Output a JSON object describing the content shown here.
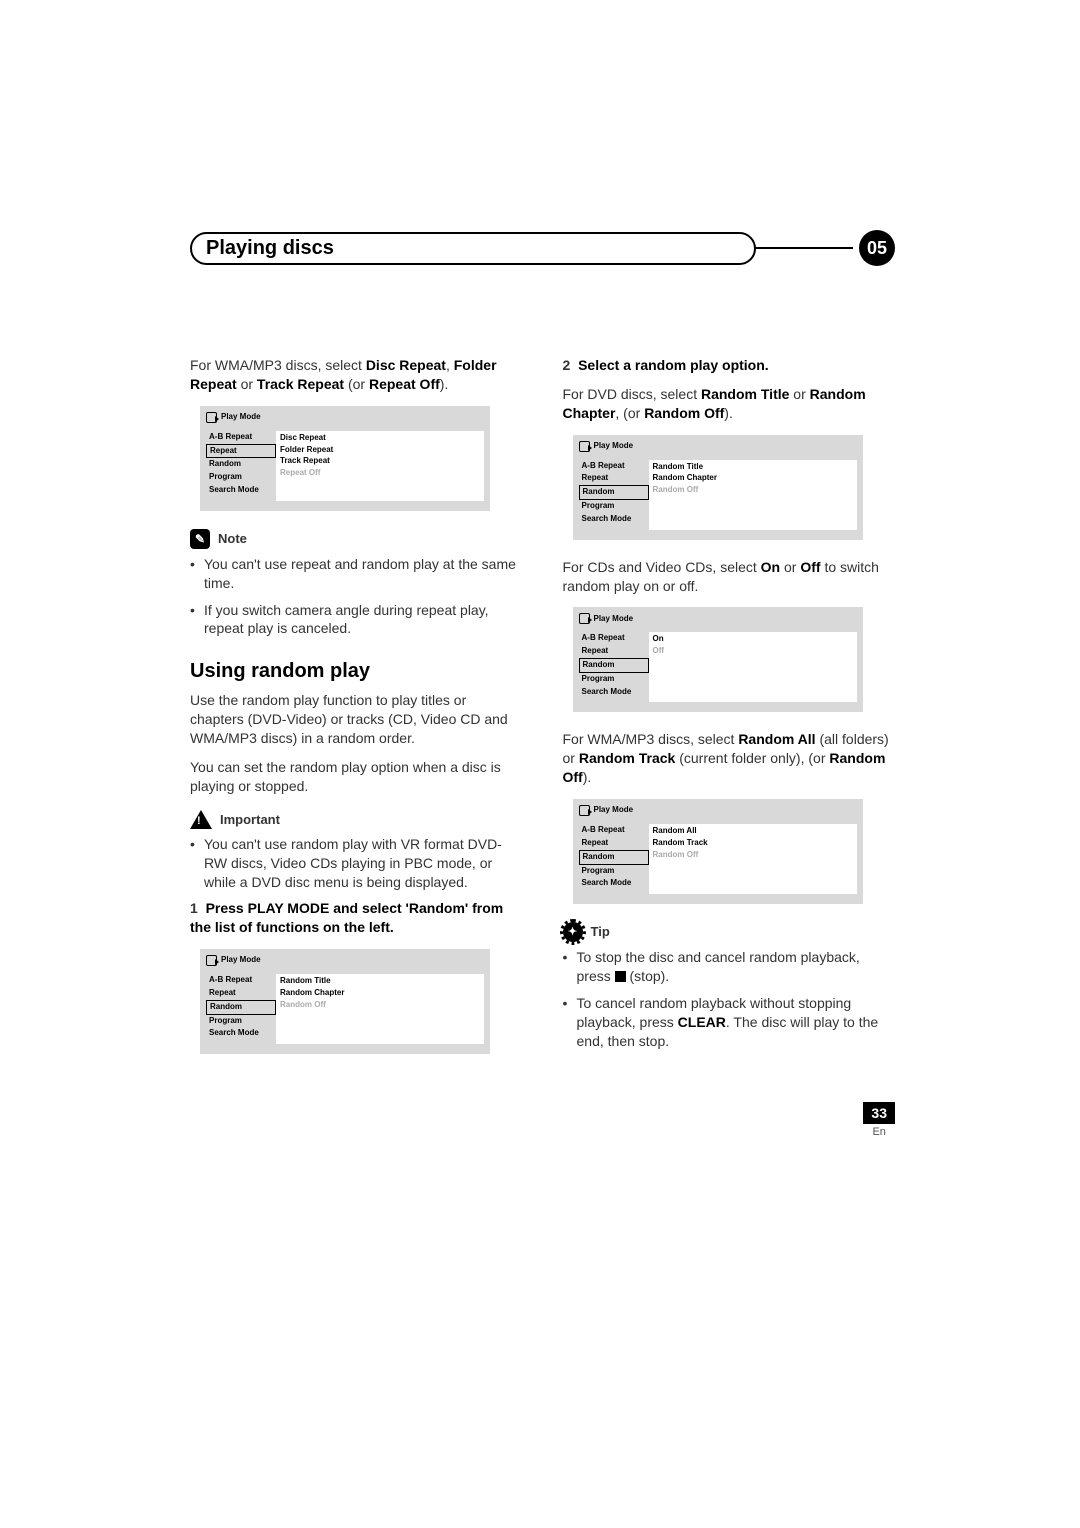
{
  "header": {
    "chapter_title": "Playing discs",
    "chapter_number": "05"
  },
  "left": {
    "intro_prefix": "For WMA/MP3 discs, select ",
    "intro_b1": "Disc Repeat",
    "intro_mid1": ", ",
    "intro_b2": "Folder Repeat",
    "intro_mid2": " or ",
    "intro_b3": "Track Repeat",
    "intro_mid3": " (or ",
    "intro_b4": "Repeat Off",
    "intro_suffix": ").",
    "menu1": {
      "title": "Play Mode",
      "left": [
        "A-B Repeat",
        "Repeat",
        "Random",
        "Program",
        "Search Mode"
      ],
      "selected": "Repeat",
      "right": [
        "Disc Repeat",
        "Folder Repeat",
        "Track Repeat"
      ],
      "right_dim": "Repeat Off"
    },
    "note_label": "Note",
    "note_items": [
      "You can't use repeat and random play at the same time.",
      "If you switch camera angle during repeat play, repeat play is canceled."
    ],
    "h2": "Using random play",
    "p1": "Use the random play function to play titles or chapters (DVD-Video) or tracks (CD, Video CD and WMA/MP3 discs) in a random order.",
    "p2": "You can set the random play option when a disc is playing or stopped.",
    "important_label": "Important",
    "important_items": [
      "You can't use random play with VR format DVD-RW discs, Video CDs playing in PBC mode, or while a DVD disc menu is being displayed."
    ],
    "step1_num": "1",
    "step1_text": "Press PLAY MODE and select 'Random' from the list of functions on the left.",
    "menu2": {
      "title": "Play Mode",
      "left": [
        "A-B Repeat",
        "Repeat",
        "Random",
        "Program",
        "Search Mode"
      ],
      "selected": "Random",
      "right": [
        "Random Title",
        "Random Chapter"
      ],
      "right_dim": "Random Off"
    }
  },
  "right": {
    "step2_num": "2",
    "step2_text": "Select a random play option.",
    "dvd_prefix": "For DVD discs, select ",
    "dvd_b1": "Random Title",
    "dvd_mid1": " or ",
    "dvd_b2": "Random Chapter",
    "dvd_mid2": ", (or ",
    "dvd_b3": "Random Off",
    "dvd_suffix": ").",
    "menu3": {
      "title": "Play Mode",
      "left": [
        "A-B Repeat",
        "Repeat",
        "Random",
        "Program",
        "Search Mode"
      ],
      "selected": "Random",
      "right": [
        "Random Title",
        "Random Chapter"
      ],
      "right_dim": "Random Off"
    },
    "cd_prefix": "For CDs and Video CDs, select ",
    "cd_b1": "On",
    "cd_mid": " or ",
    "cd_b2": "Off",
    "cd_suffix": " to switch random play on or off.",
    "menu4": {
      "title": "Play Mode",
      "left": [
        "A-B Repeat",
        "Repeat",
        "Random",
        "Program",
        "Search Mode"
      ],
      "selected": "Random",
      "right": [
        "On"
      ],
      "right_dim": "Off"
    },
    "wma_prefix": "For WMA/MP3 discs, select ",
    "wma_b1": "Random All",
    "wma_mid1": " (all folders) or ",
    "wma_b2": "Random Track",
    "wma_mid2": " (current folder only), (or ",
    "wma_b3": "Random Off",
    "wma_suffix": ").",
    "menu5": {
      "title": "Play Mode",
      "left": [
        "A-B Repeat",
        "Repeat",
        "Random",
        "Program",
        "Search Mode"
      ],
      "selected": "Random",
      "right": [
        "Random All",
        "Random Track"
      ],
      "right_dim": "Random Off"
    },
    "tip_label": "Tip",
    "tip1_a": "To stop the disc and cancel random playback, press ",
    "tip1_b": " (stop).",
    "tip2_a": "To cancel random playback without stopping playback, press ",
    "tip2_bold": "CLEAR",
    "tip2_b": ". The disc will play to the end, then stop."
  },
  "footer": {
    "page": "33",
    "lang": "En"
  }
}
